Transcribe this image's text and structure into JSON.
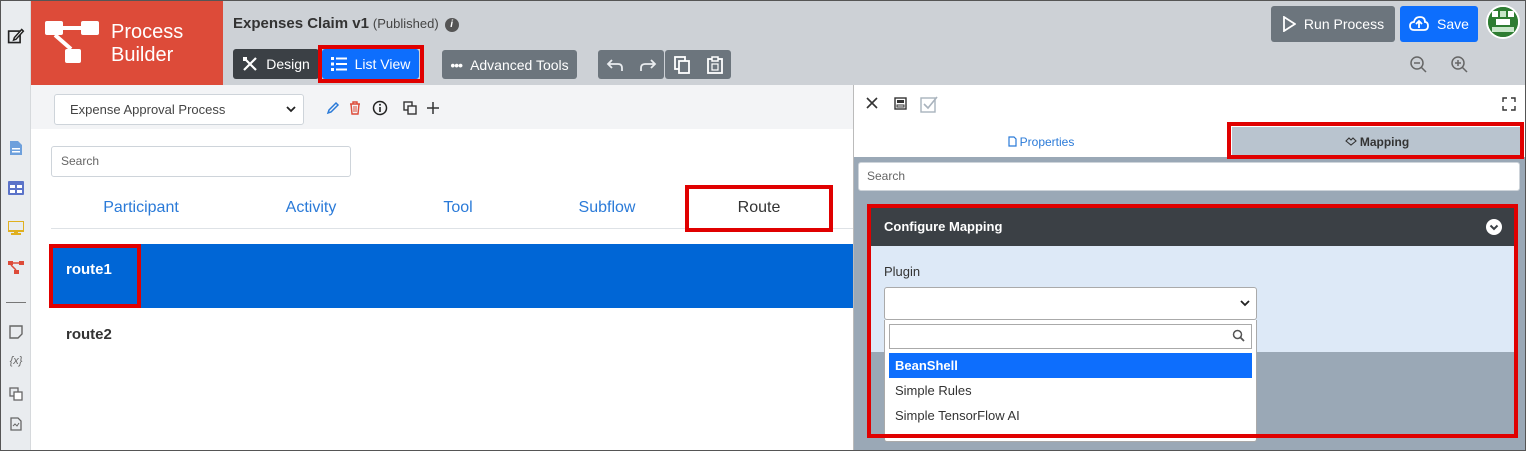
{
  "header": {
    "logo_text_line1": "Process",
    "logo_text_line2": "Builder",
    "app_title": "Expenses Claim v1",
    "app_status": "(Published)",
    "info_icon": "i",
    "design_label": "Design",
    "list_view_label": "List View",
    "advanced_tools_label": "Advanced Tools",
    "run_process_label": "Run Process",
    "save_label": "Save"
  },
  "main": {
    "process_selected": "Expense Approval Process",
    "search_placeholder": "Search",
    "tabs": [
      {
        "label": "Participant"
      },
      {
        "label": "Activity"
      },
      {
        "label": "Tool"
      },
      {
        "label": "Subflow"
      },
      {
        "label": "Route"
      }
    ],
    "active_tab": "Route",
    "rows": [
      {
        "label": "route1"
      },
      {
        "label": "route2"
      }
    ]
  },
  "panel": {
    "tab_properties": "Properties",
    "tab_mapping": "Mapping",
    "search_placeholder": "Search",
    "configure_title": "Configure Mapping",
    "plugin_label": "Plugin",
    "plugin_value": "",
    "dropdown_options": [
      {
        "label": "BeanShell"
      },
      {
        "label": "Simple Rules"
      },
      {
        "label": "Simple TensorFlow AI"
      }
    ],
    "dropdown_highlighted": "BeanShell"
  },
  "colors": {
    "brand_red": "#dd4b39",
    "primary_blue": "#0d6efd",
    "dark": "#3b4045",
    "highlight_red": "#e00000"
  }
}
